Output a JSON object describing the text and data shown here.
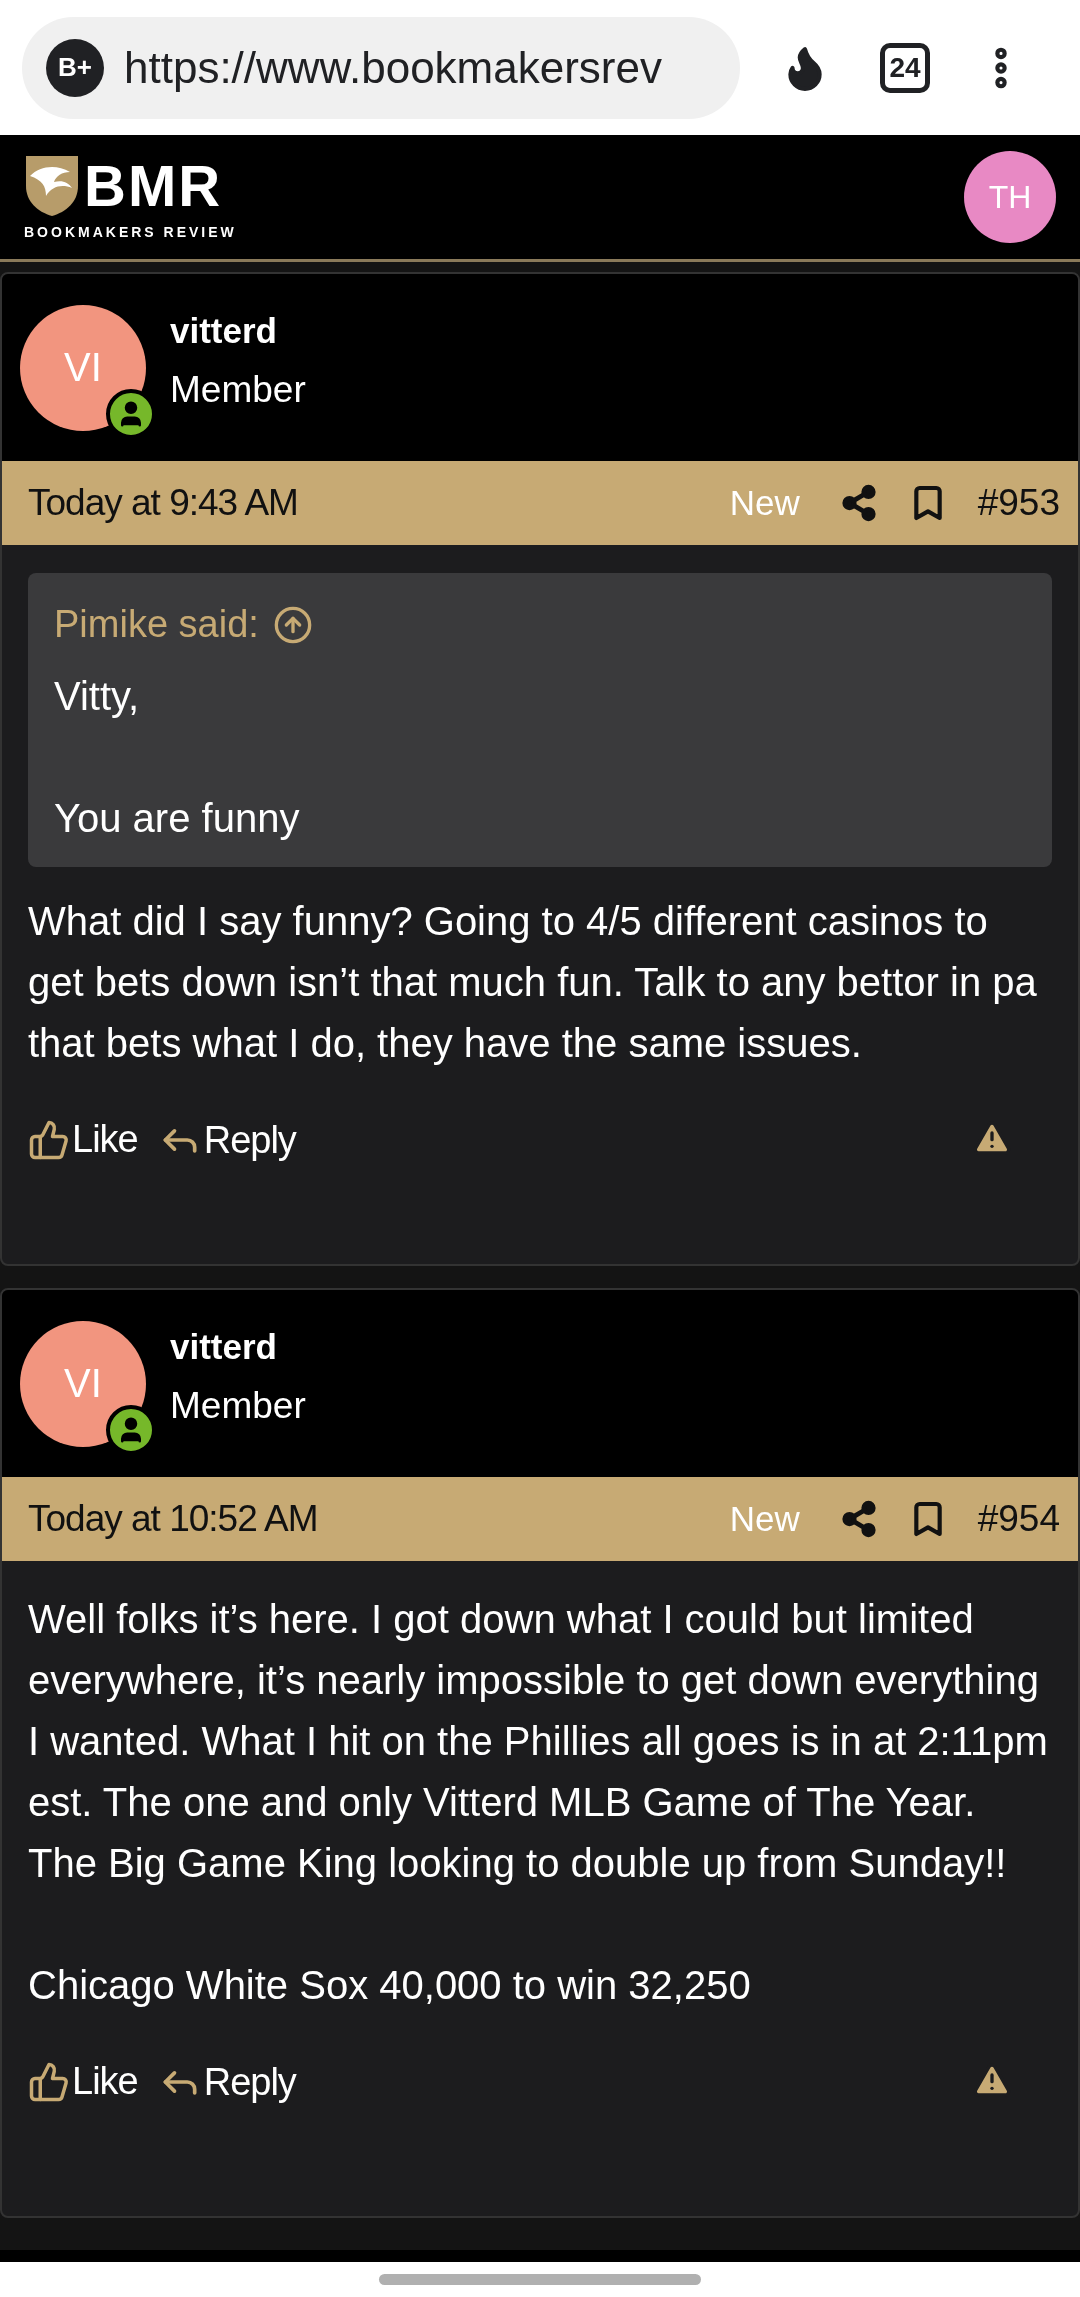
{
  "browser": {
    "site_badge": "B+",
    "url": "https://www.bookmakersrev",
    "tab_count": "24"
  },
  "site_header": {
    "logo": {
      "wordmark": "BMR",
      "tagline": "BOOKMAKERS REVIEW"
    },
    "user_avatar": "TH"
  },
  "posts": [
    {
      "avatar": "VI",
      "username": "vitterd",
      "role": "Member",
      "online": true,
      "time": "Today at 9:43 AM",
      "badge": "New",
      "number": "#953",
      "quote": {
        "author": "Pimike said:",
        "paragraphs": [
          "Vitty,",
          "You are funny"
        ]
      },
      "paragraphs": [
        "What did I say funny? Going to 4/5 different casinos to get bets down isn’t that much fun. Talk to any bettor in pa that bets what I do, they have the same issues."
      ],
      "actions": [
        "Like",
        "Reply"
      ]
    },
    {
      "avatar": "VI",
      "username": "vitterd",
      "role": "Member",
      "online": true,
      "time": "Today at 10:52 AM",
      "badge": "New",
      "number": "#954",
      "paragraphs": [
        "Well folks it’s here. I got down what I could but limited everywhere, it’s nearly impossible to get down everything I wanted. What I hit on the Phillies all goes is in at 2:11pm est. The one and only Vitterd MLB Game of The Year. The Big Game King looking to double up from Sunday!!",
        "Chicago White Sox 40,000 to win 32,250"
      ],
      "actions": [
        "Like",
        "Reply"
      ]
    }
  ]
}
